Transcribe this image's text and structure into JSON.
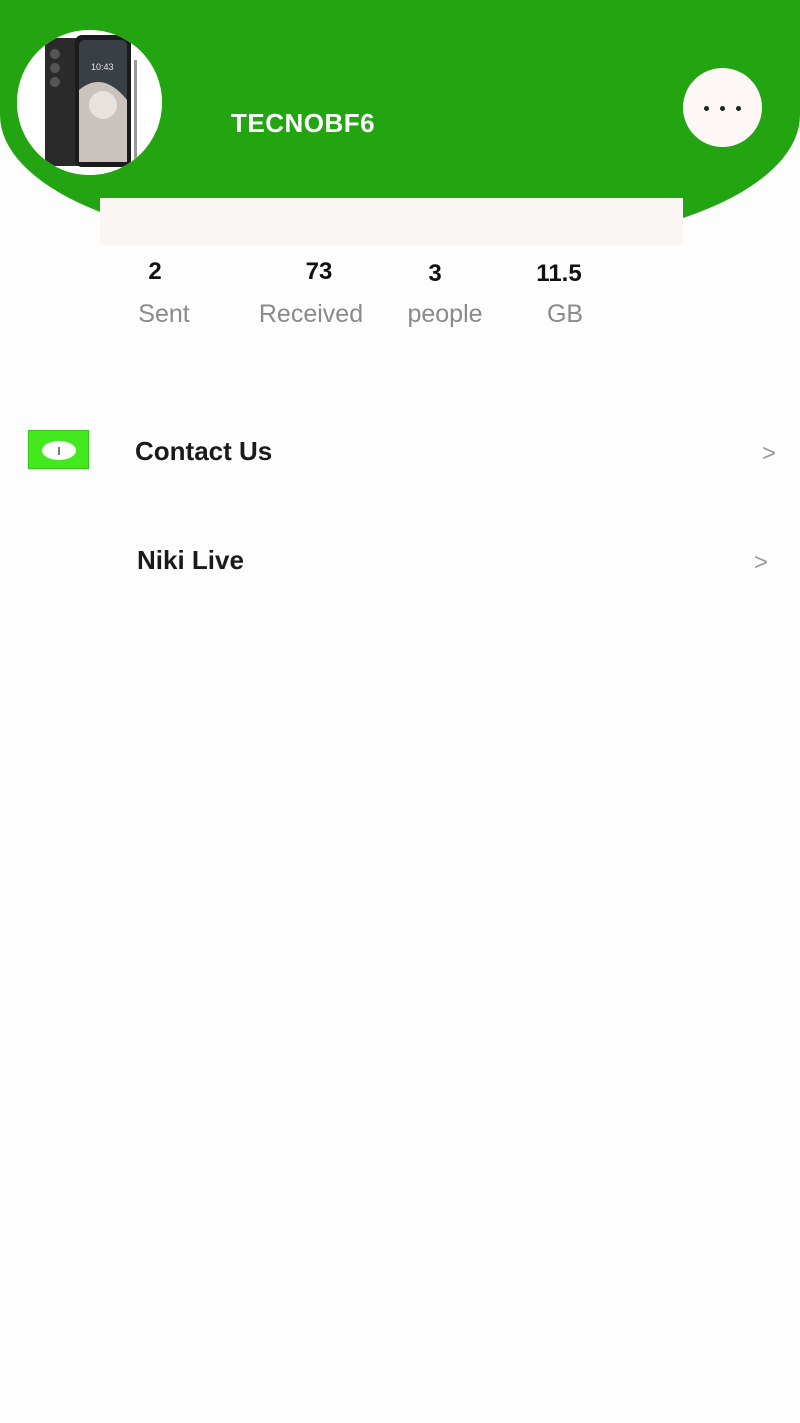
{
  "profile": {
    "username": "TECNOBF6",
    "avatar": "phone-avatar-image",
    "more_icon": "more-dots-icon"
  },
  "stats": [
    {
      "value": "2",
      "label": "Sent"
    },
    {
      "value": "73",
      "label": "Received"
    },
    {
      "value": "3",
      "label": "people"
    },
    {
      "value": "11.5",
      "label": "GB"
    }
  ],
  "menu": {
    "items": [
      {
        "label": "Contact Us",
        "chevron": ">",
        "icon": "info-icon"
      },
      {
        "label": "Niki Live",
        "chevron": ">"
      }
    ]
  },
  "colors": {
    "brand_green": "#23a411",
    "icon_green": "#43e81e",
    "background": "#fdfdfd"
  }
}
